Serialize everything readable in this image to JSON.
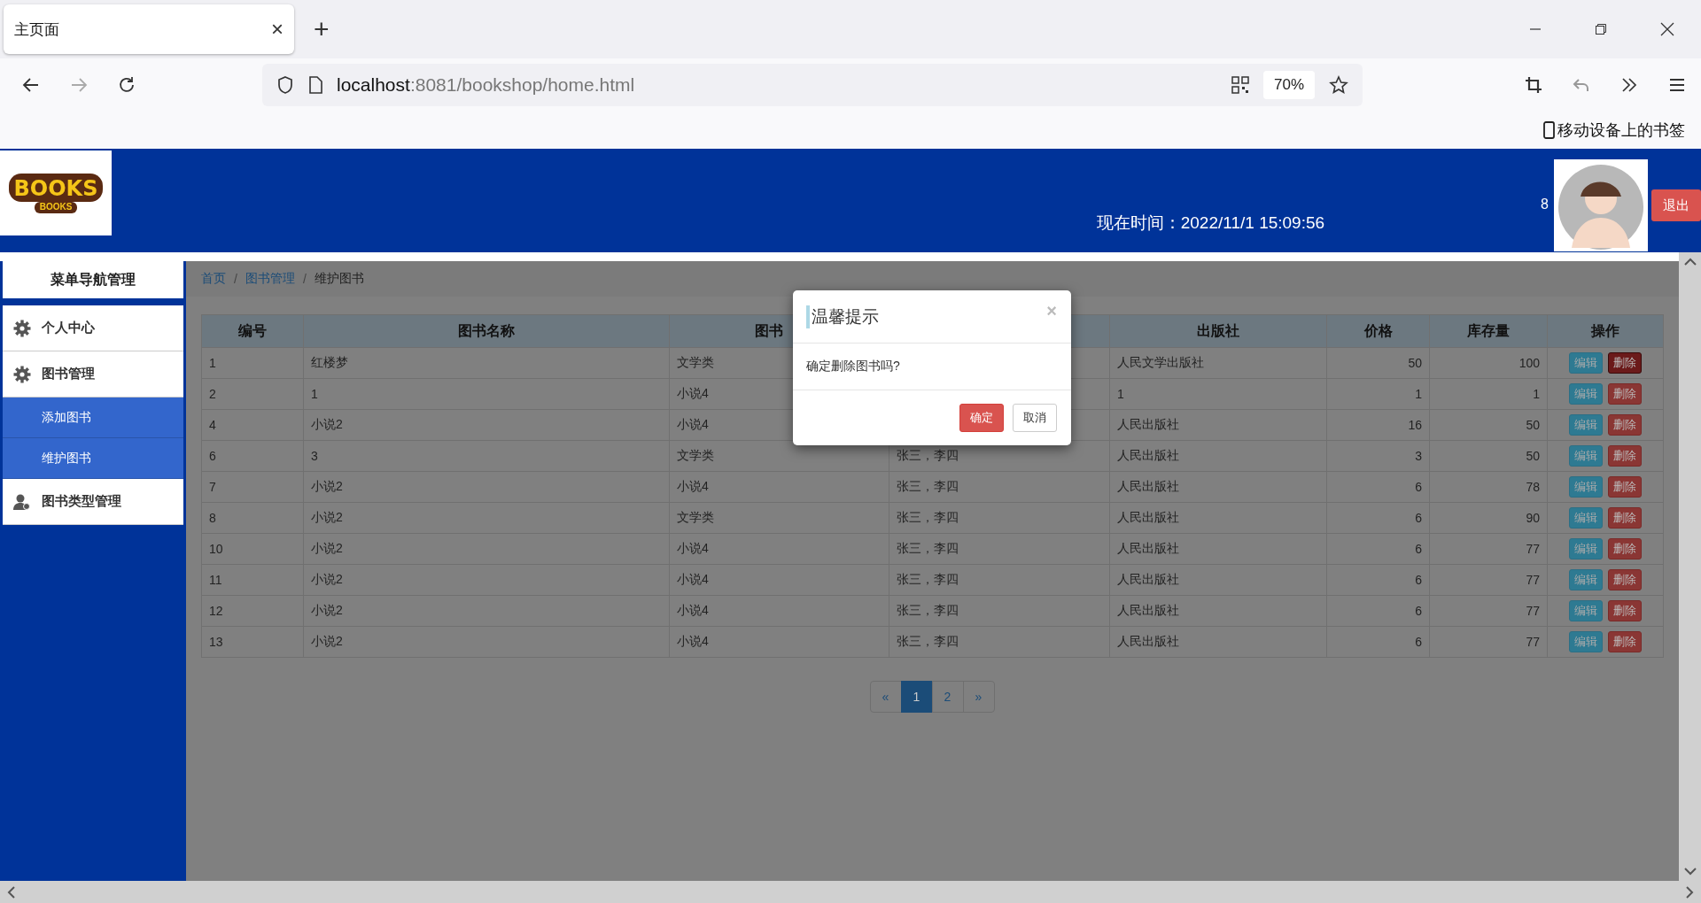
{
  "browser": {
    "tab": {
      "title": "主页面",
      "close": "×"
    },
    "new_tab": "+",
    "url": {
      "host": "localhost",
      "path": ":8081/bookshop/home.html"
    },
    "zoom": "70%",
    "bookmarks": "移动设备上的书签"
  },
  "header": {
    "logo": {
      "text": "BOOKS",
      "subtext": "BOOKS"
    },
    "time": "现在时间：2022/11/1 15:09:56",
    "user_count": "8",
    "logout": "退出"
  },
  "sidebar": {
    "title": "菜单导航管理",
    "items": [
      {
        "label": "个人中心",
        "kind": "settings"
      },
      {
        "label": "图书管理",
        "kind": "settings",
        "expanded": true,
        "children": [
          {
            "label": "添加图书"
          },
          {
            "label": "维护图书"
          }
        ]
      },
      {
        "label": "图书类型管理",
        "kind": "user"
      }
    ]
  },
  "breadcrumb": [
    {
      "label": "首页",
      "link": true
    },
    {
      "separator": "/",
      "label": "图书管理",
      "link": true
    },
    {
      "separator": "/",
      "label": "维护图书",
      "link": false
    }
  ],
  "table": {
    "columns": [
      "编号",
      "图书名称",
      "图书"
    ],
    "column_5": "出版社",
    "column_6": "价格",
    "column_7": "库存量",
    "column_8": "操作",
    "rows": [
      {
        "id": "1",
        "name": "红楼梦",
        "type": "文学类",
        "publisher": "人民文学出版社",
        "price": "50",
        "stock": "100",
        "focused": true,
        "actions": [
          "编辑",
          "删除"
        ]
      },
      {
        "id": "2",
        "name": "1",
        "type": "小说4",
        "publisher": "1",
        "price": "1",
        "stock": "1",
        "focused": false,
        "actions": [
          "编辑",
          "删除"
        ]
      },
      {
        "id": "4",
        "name": "小说2",
        "type": "小说4",
        "publisher": "人民出版社",
        "price": "16",
        "stock": "50",
        "focused": false,
        "actions": [
          "编辑",
          "删除"
        ]
      },
      {
        "id": "6",
        "name": "3",
        "type": "文学类",
        "author": "张三，李四",
        "publisher": "人民出版社",
        "price": "3",
        "stock": "50",
        "focused": false,
        "actions": [
          "编辑",
          "删除"
        ]
      },
      {
        "id": "7",
        "name": "小说2",
        "type": "小说4",
        "author": "张三，李四",
        "publisher": "人民出版社",
        "price": "6",
        "stock": "78",
        "focused": false,
        "actions": [
          "编辑",
          "删除"
        ]
      },
      {
        "id": "8",
        "name": "小说2",
        "type": "文学类",
        "author": "张三，李四",
        "publisher": "人民出版社",
        "price": "6",
        "stock": "90",
        "focused": false,
        "actions": [
          "编辑",
          "删除"
        ]
      },
      {
        "id": "10",
        "name": "小说2",
        "type": "小说4",
        "author": "张三，李四",
        "publisher": "人民出版社",
        "price": "6",
        "stock": "77",
        "focused": false,
        "actions": [
          "编辑",
          "删除"
        ]
      },
      {
        "id": "11",
        "name": "小说2",
        "type": "小说4",
        "author": "张三，李四",
        "publisher": "人民出版社",
        "price": "6",
        "stock": "77",
        "focused": false,
        "actions": [
          "编辑",
          "删除"
        ]
      },
      {
        "id": "12",
        "name": "小说2",
        "type": "小说4",
        "author": "张三，李四",
        "publisher": "人民出版社",
        "price": "6",
        "stock": "77",
        "focused": false,
        "actions": [
          "编辑",
          "删除"
        ]
      },
      {
        "id": "13",
        "name": "小说2",
        "type": "小说4",
        "author": "张三，李四",
        "publisher": "人民出版社",
        "price": "6",
        "stock": "77",
        "focused": false,
        "actions": [
          "编辑",
          "删除"
        ]
      }
    ]
  },
  "pagination": [
    {
      "label": "«",
      "selected": false
    },
    {
      "label": "1",
      "selected": true
    },
    {
      "label": "2",
      "selected": false
    },
    {
      "label": "»",
      "selected": false
    }
  ],
  "dialog": {
    "title": "温馨提示",
    "close": "×",
    "message": "确定删除图书吗?",
    "confirm": "确定",
    "cancel": "取消"
  }
}
